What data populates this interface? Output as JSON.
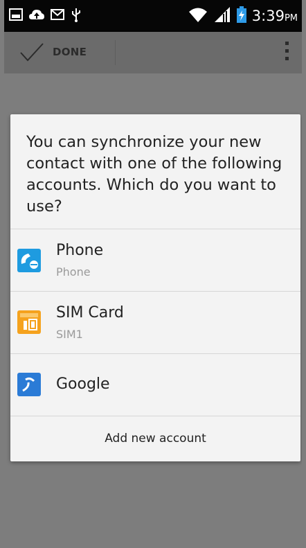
{
  "status_bar": {
    "icons_left": [
      "gallery-icon",
      "cloud-upload-icon",
      "gmail-icon",
      "usb-icon"
    ],
    "icons_right": [
      "wifi-icon",
      "signal-icon",
      "battery-charging-icon"
    ],
    "time": "3:39",
    "ampm": "PM"
  },
  "action_bar": {
    "done_label": "DONE"
  },
  "dialog": {
    "message": "You can synchronize your new contact with one of the following accounts. Which do you want to use?",
    "accounts": [
      {
        "name": "Phone",
        "type": "Phone",
        "icon": "phone-contact-icon"
      },
      {
        "name": "SIM Card",
        "type": "SIM1",
        "icon": "sim-card-icon"
      },
      {
        "name": "Google",
        "type": "",
        "icon": "google-icon"
      }
    ],
    "add_account_label": "Add new account"
  },
  "colors": {
    "status_bar_bg": "#060606",
    "scrim": "#7d7d7d",
    "action_bar_bg": "#6b6b6b",
    "dialog_bg": "#f3f3f3",
    "phone_icon": "#1e9be0",
    "sim_icon": "#f5a21d",
    "google_icon": "#2b7bd6"
  }
}
